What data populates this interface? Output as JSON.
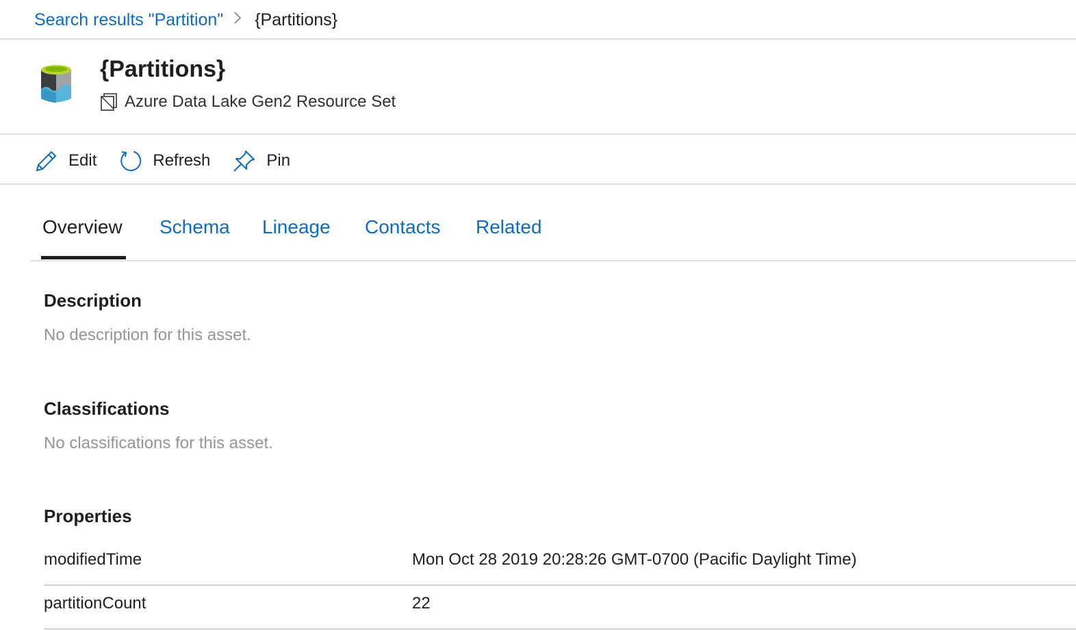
{
  "breadcrumb": {
    "parent": "Search results \"Partition\"",
    "current": "{Partitions}"
  },
  "asset": {
    "title": "{Partitions}",
    "type": "Azure Data Lake Gen2 Resource Set",
    "icon": "data-lake-storage-icon",
    "type_icon": "resource-set-icon"
  },
  "toolbar": {
    "edit_label": "Edit",
    "refresh_label": "Refresh",
    "pin_label": "Pin",
    "edit_icon": "pencil-icon",
    "refresh_icon": "refresh-icon",
    "pin_icon": "pin-icon"
  },
  "tabs": [
    {
      "label": "Overview",
      "active": true
    },
    {
      "label": "Schema",
      "active": false
    },
    {
      "label": "Lineage",
      "active": false
    },
    {
      "label": "Contacts",
      "active": false
    },
    {
      "label": "Related",
      "active": false
    }
  ],
  "description": {
    "title": "Description",
    "empty_text": "No description for this asset."
  },
  "classifications": {
    "title": "Classifications",
    "empty_text": "No classifications for this asset."
  },
  "properties": {
    "title": "Properties",
    "rows": [
      {
        "key": "modifiedTime",
        "value": "Mon Oct 28 2019 20:28:26 GMT-0700 (Pacific Daylight Time)"
      },
      {
        "key": "partitionCount",
        "value": "22"
      }
    ]
  },
  "colors": {
    "link": "#0f6cbd",
    "text": "#201f1e",
    "muted": "#979593",
    "divider": "#e1dfdd"
  }
}
